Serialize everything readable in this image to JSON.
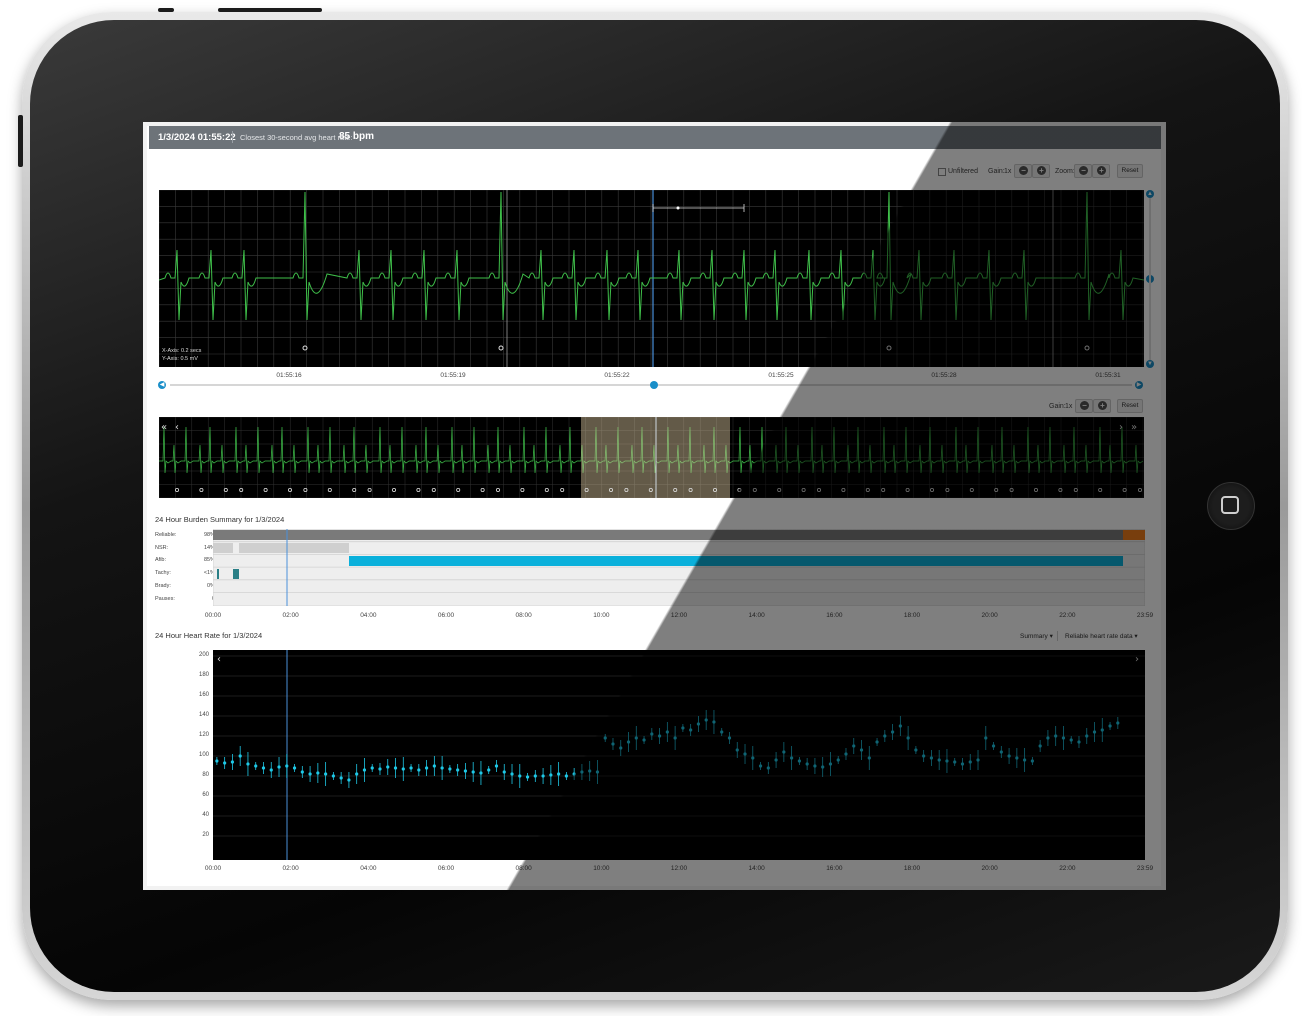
{
  "header": {
    "date": "1/3/2024 01:55:22",
    "avg_label": "Closest 30-second avg heart rate:",
    "avg_value": "85 bpm"
  },
  "controls": {
    "unfiltered_label": "Unfiltered",
    "gain_label": "Gain:",
    "gain_value": "1x",
    "zoom_label": "Zoom:",
    "reset_label": "Reset",
    "gain2_label": "Gain:",
    "gain2_value": "1x",
    "reset2_label": "Reset"
  },
  "strip": {
    "x_axis_note": "X-Axis: 0.2 secs",
    "y_axis_note": "Y-Axis: 0.5 mV",
    "time_ticks": [
      "01:55:16",
      "01:55:19",
      "01:55:22",
      "01:55:25",
      "01:55:28",
      "01:55:31"
    ],
    "slider_position": 0.5
  },
  "burden": {
    "title": "24 Hour Burden Summary for 1/3/2024",
    "rows": [
      {
        "name": "Reliable:",
        "pct": "98%"
      },
      {
        "name": "NSR:",
        "pct": "14%"
      },
      {
        "name": "Afib:",
        "pct": "85%"
      },
      {
        "name": "Tachy:",
        "pct": "<1%"
      },
      {
        "name": "Brady:",
        "pct": "0%"
      },
      {
        "name": "Pauses:",
        "pct": "0"
      }
    ],
    "time_ticks": [
      "00:00",
      "02:00",
      "04:00",
      "06:00",
      "08:00",
      "10:00",
      "12:00",
      "14:00",
      "16:00",
      "18:00",
      "20:00",
      "22:00",
      "23:59"
    ],
    "colors": {
      "reliable": "#7a7a7a",
      "unreliable": "#f07c1a",
      "nsr": "#cfcfcf",
      "afib": "#0ab0db",
      "tachy": "#2a7f86"
    }
  },
  "heart_rate": {
    "title": "24 Hour Heart Rate for 1/3/2024",
    "summary_dropdown": "Summary",
    "data_dropdown": "Reliable heart rate data"
  },
  "chart_data": {
    "type": "scatter",
    "title": "24 Hour Heart Rate for 1/3/2024",
    "xlabel": "",
    "ylabel": "",
    "ylim": [
      0,
      200
    ],
    "y_ticks": [
      20,
      40,
      60,
      80,
      100,
      120,
      140,
      160,
      180,
      200
    ],
    "x_ticks": [
      "00:00",
      "02:00",
      "04:00",
      "06:00",
      "08:00",
      "10:00",
      "12:00",
      "14:00",
      "16:00",
      "18:00",
      "20:00",
      "22:00",
      "23:59"
    ],
    "grid": true,
    "series": [
      {
        "color": "#1ec8e6",
        "x_hours": [
          0.1,
          0.3,
          0.5,
          0.7,
          0.9,
          1.1,
          1.3,
          1.5,
          1.7,
          1.9,
          2.1,
          2.3,
          2.5,
          2.7,
          2.9,
          3.1,
          3.3,
          3.5,
          3.7,
          3.9,
          4.1,
          4.3,
          4.5,
          4.7,
          4.9,
          5.1,
          5.3,
          5.5,
          5.7,
          5.9,
          6.1,
          6.3,
          6.5,
          6.7,
          6.9,
          7.1,
          7.3,
          7.5,
          7.7,
          7.9,
          8.1,
          8.3,
          8.5,
          8.7,
          8.9,
          9.1,
          9.3,
          9.5,
          9.7,
          9.9,
          10.1,
          10.3,
          10.5,
          10.7,
          10.9,
          11.1,
          11.3,
          11.5,
          11.7,
          11.9,
          12.1,
          12.3,
          12.5,
          12.7,
          12.9,
          13.1,
          13.3,
          13.5,
          13.7,
          13.9,
          14.1,
          14.3,
          14.5,
          14.7,
          14.9,
          15.1,
          15.3,
          15.5,
          15.7,
          15.9,
          16.1,
          16.3,
          16.5,
          16.7,
          16.9,
          17.1,
          17.3,
          17.5,
          17.7,
          17.9,
          18.1,
          18.3,
          18.5,
          18.7,
          18.9,
          19.1,
          19.3,
          19.5,
          19.7,
          19.9,
          20.1,
          20.3,
          20.5,
          20.7,
          20.9,
          21.1,
          21.3,
          21.5,
          21.7,
          21.9,
          22.1,
          22.3,
          22.5,
          22.7,
          22.9,
          23.1,
          23.3,
          23.5
        ],
        "values": [
          95,
          93,
          94,
          100,
          92,
          90,
          88,
          86,
          89,
          90,
          88,
          84,
          82,
          83,
          82,
          80,
          78,
          76,
          82,
          86,
          88,
          87,
          89,
          88,
          87,
          88,
          86,
          88,
          90,
          88,
          87,
          86,
          85,
          84,
          83,
          86,
          90,
          84,
          82,
          80,
          79,
          80,
          80,
          81,
          82,
          80,
          82,
          84,
          85,
          84,
          118,
          112,
          108,
          114,
          118,
          116,
          122,
          120,
          124,
          118,
          128,
          126,
          132,
          136,
          134,
          124,
          118,
          106,
          102,
          98,
          90,
          88,
          96,
          104,
          98,
          95,
          92,
          90,
          89,
          92,
          96,
          102,
          110,
          106,
          98,
          114,
          120,
          124,
          130,
          118,
          106,
          100,
          98,
          96,
          95,
          94,
          92,
          94,
          96,
          118,
          110,
          104,
          100,
          98,
          96,
          95,
          110,
          118,
          120,
          118,
          116,
          114,
          120,
          124,
          126,
          130,
          133
        ]
      }
    ]
  }
}
